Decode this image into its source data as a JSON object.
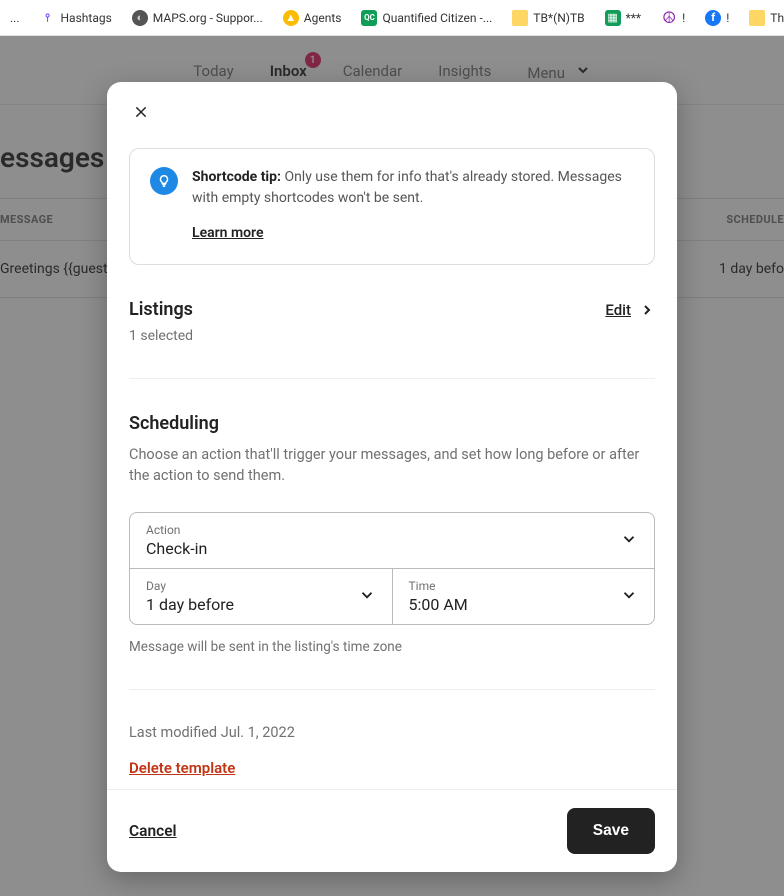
{
  "bookmarks": {
    "b0": "...",
    "b1": "Hashtags",
    "b2": "MAPS.org - Suppor...",
    "b3": "Agents",
    "b4": "Quantified Citizen -...",
    "b5": "TB*(N)TB",
    "b6": "***",
    "b7": "!",
    "b8": "!",
    "b9": "The D"
  },
  "nav": {
    "today": "Today",
    "inbox": "Inbox",
    "inbox_badge": "1",
    "calendar": "Calendar",
    "insights": "Insights",
    "menu": "Menu"
  },
  "background": {
    "heading": "essages",
    "col_message": "MESSAGE",
    "col_schedule": "SCHEDULE",
    "row_message": "Greetings {{guest first",
    "row_schedule": "1 day befo"
  },
  "modal": {
    "tip_label": "Shortcode tip:",
    "tip_text": "Only use them for info that's already stored. Messages with empty shortcodes won't be sent.",
    "tip_learn": "Learn more",
    "listings_title": "Listings",
    "listings_edit": "Edit",
    "listings_selected": "1 selected",
    "sched_title": "Scheduling",
    "sched_desc": "Choose an action that'll trigger your messages, and set how long before or after the action to send them.",
    "action_label": "Action",
    "action_value": "Check-in",
    "day_label": "Day",
    "day_value": "1 day before",
    "time_label": "Time",
    "time_value": "5:00 AM",
    "tz_hint": "Message will be sent in the listing's time zone",
    "last_modified": "Last modified Jul. 1, 2022",
    "delete": "Delete template",
    "cancel": "Cancel",
    "save": "Save"
  }
}
